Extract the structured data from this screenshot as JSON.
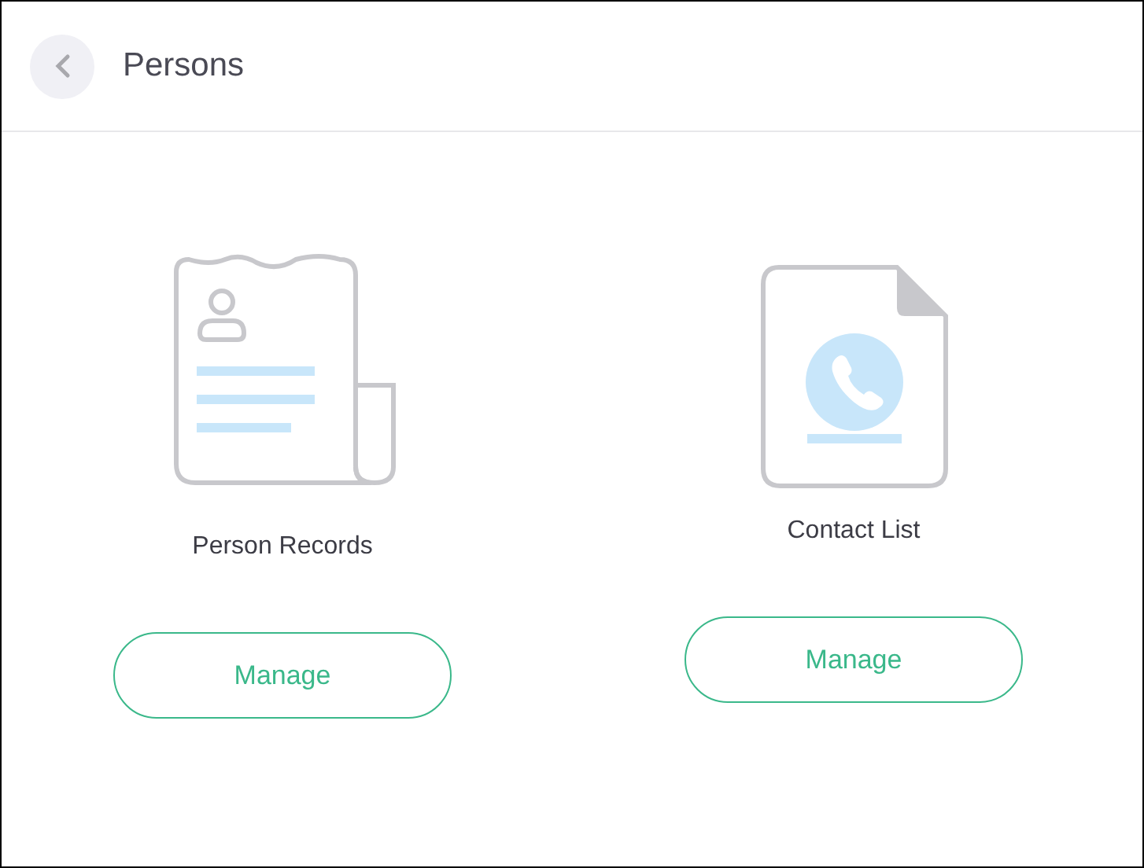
{
  "header": {
    "title": "Persons"
  },
  "cards": [
    {
      "kind": "records",
      "label": "Person Records",
      "button": "Manage"
    },
    {
      "kind": "contacts",
      "label": "Contact List",
      "button": "Manage"
    }
  ]
}
